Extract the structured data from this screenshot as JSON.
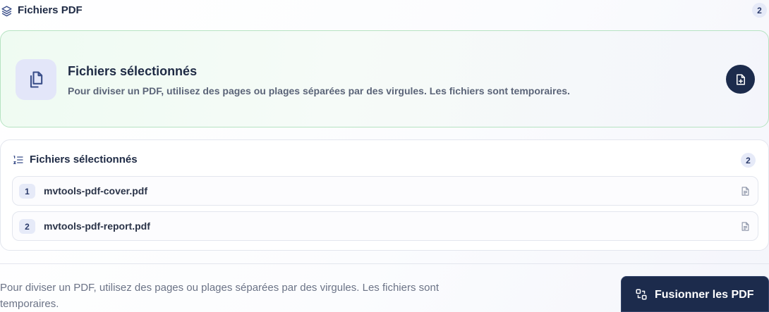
{
  "header": {
    "title": "Fichiers PDF",
    "count": "2",
    "icon": "layers-icon"
  },
  "hero": {
    "title": "Fichiers sélectionnés",
    "subtitle": "Pour diviser un PDF, utilisez des pages ou plages séparées par des virgules. Les fichiers sont temporaires.",
    "icon": "copy-files-icon",
    "add_button_icon": "file-plus-icon"
  },
  "file_list": {
    "title": "Fichiers sélectionnés",
    "count": "2",
    "icon": "ordered-list-icon",
    "items": [
      {
        "index": "1",
        "name": "mvtools-pdf-cover.pdf",
        "icon": "file-text-icon"
      },
      {
        "index": "2",
        "name": "mvtools-pdf-report.pdf",
        "icon": "file-text-icon"
      }
    ]
  },
  "footer": {
    "note": "Pour diviser un PDF, utilisez des pages ou plages séparées par des virgules. Les fichiers sont temporaires.",
    "merge_label": "Fusionner les PDF",
    "merge_icon": "merge-icon"
  },
  "colors": {
    "primary": "#1c2b4c",
    "hero_border": "#b6e3c2",
    "badge_bg": "#e6eaf8"
  }
}
